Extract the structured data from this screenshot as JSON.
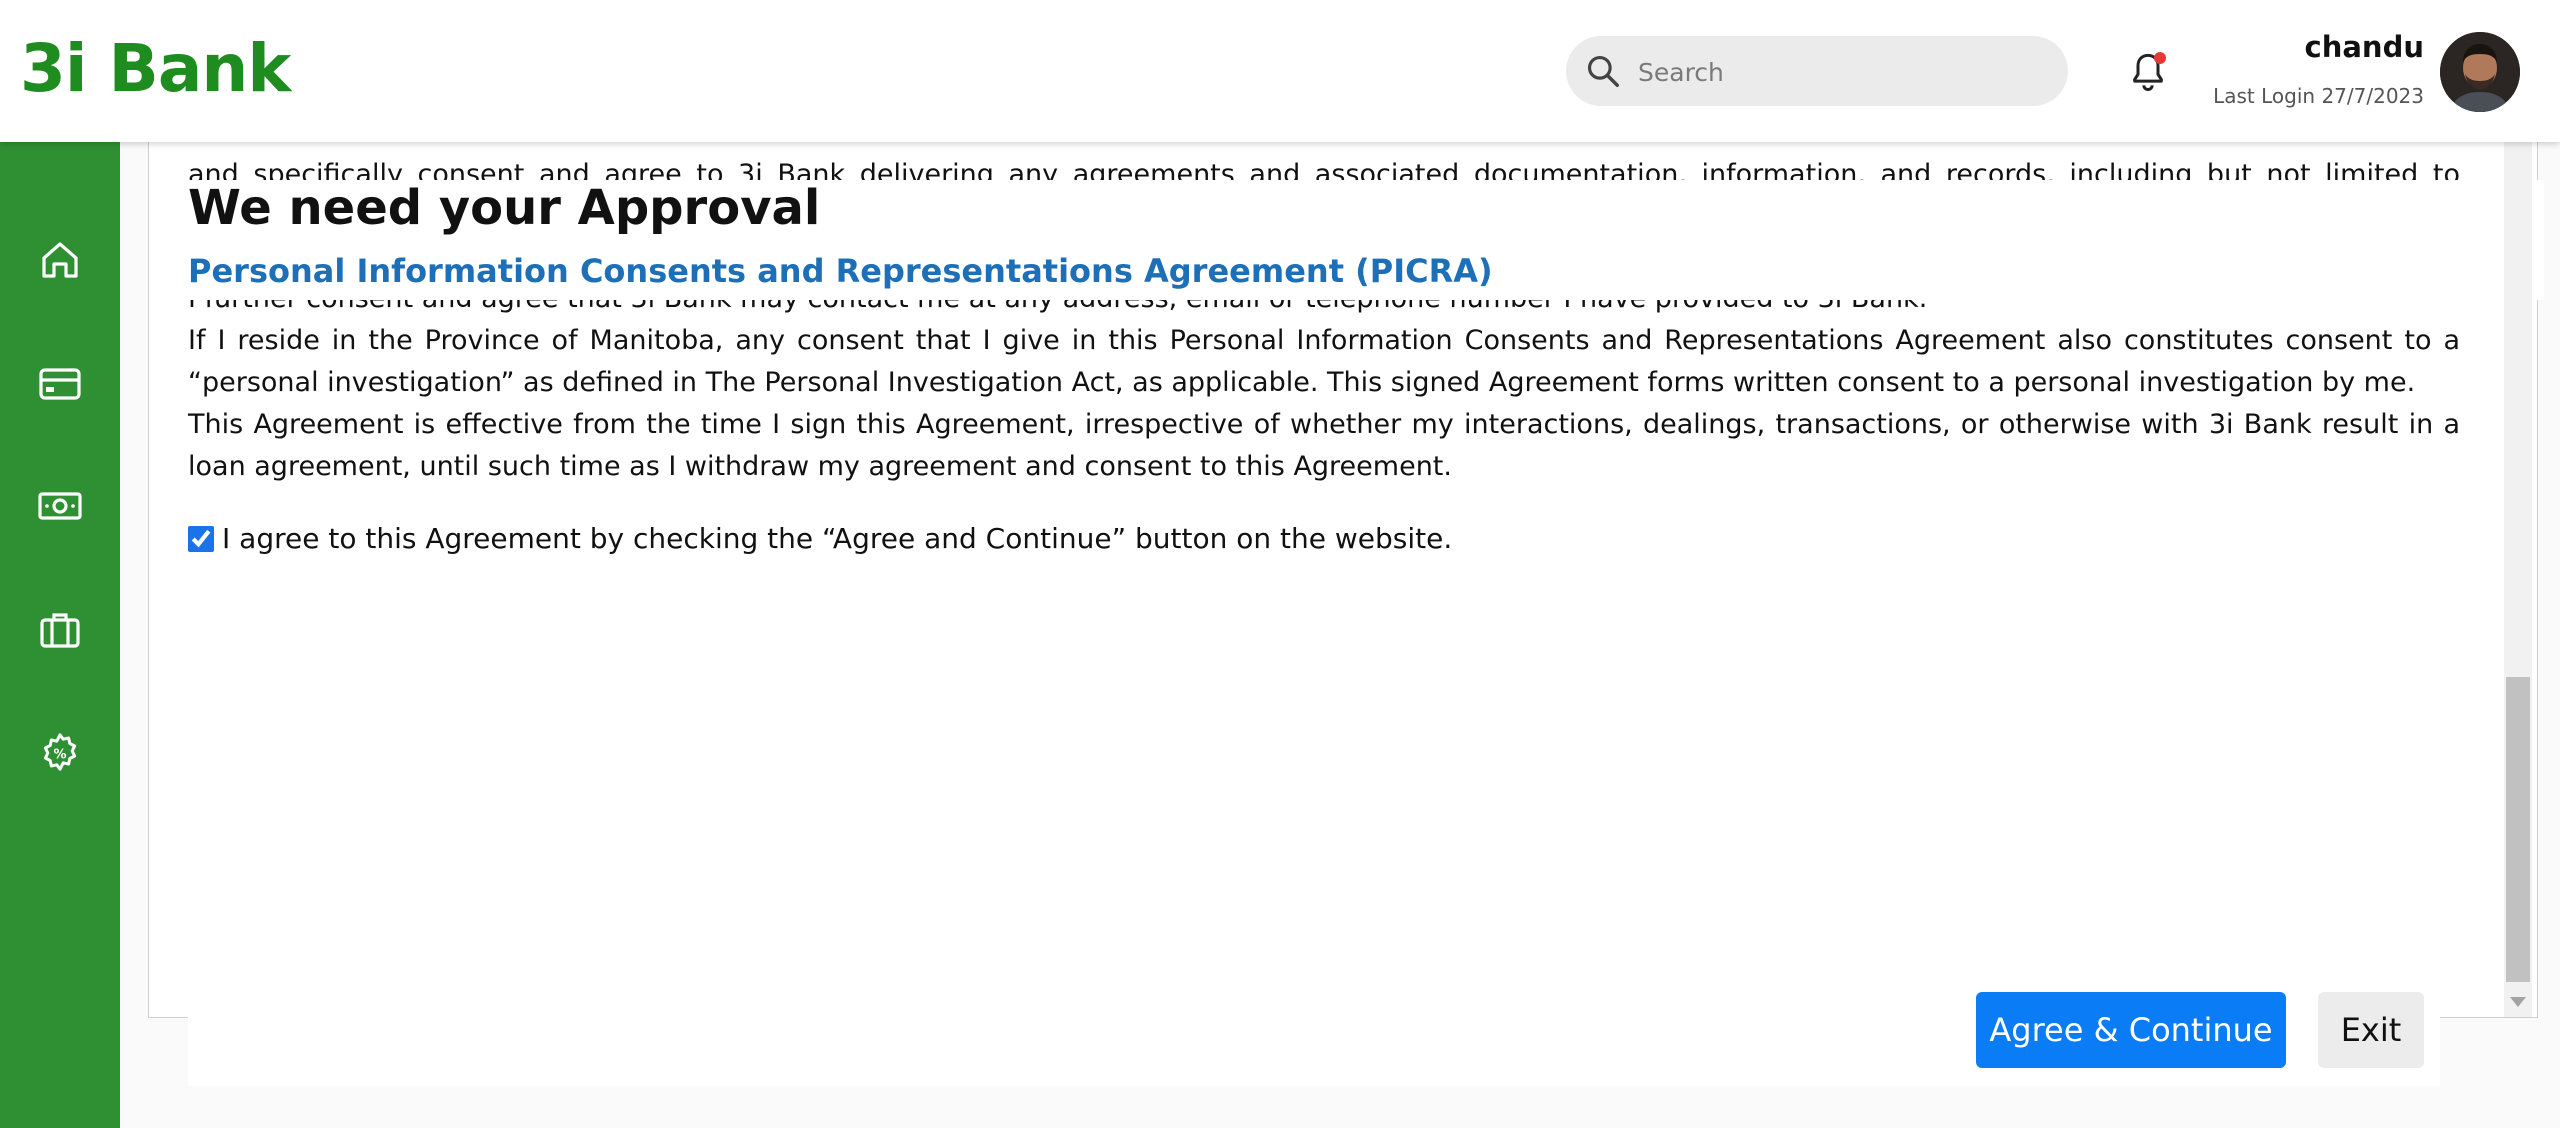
{
  "header": {
    "logo": "3i Bank",
    "search_placeholder": "Search",
    "user_name": "chandu",
    "last_login": "Last Login 27/7/2023",
    "notification_dot_color": "#e53935"
  },
  "sidebar": {
    "items": [
      {
        "icon": "home-icon"
      },
      {
        "icon": "credit-card-icon"
      },
      {
        "icon": "money-icon"
      },
      {
        "icon": "briefcase-icon"
      },
      {
        "icon": "percent-gear-icon"
      }
    ],
    "color": "#2f8f33"
  },
  "main": {
    "title": "We need your Approval",
    "subtitle": "Personal Information Consents and Representations Agreement (PICRA)",
    "scrolled_line_top": "and specifically consent and agree to 3i Bank delivering any agreements and associated documentation, information, and records, including but not limited to disclosures",
    "scrolled_line_under": "I further consent and agree that 3i Bank may contact me at any address, email or telephone number I have provided to 3i Bank.",
    "paragraphs": [
      "If I reside in the Province of Manitoba, any consent that I give in this Personal Information Consents and Representations Agreement also constitutes consent to a “personal investigation” as defined in The Personal Investigation Act, as applicable. This signed Agreement forms written consent to a personal investigation by me.",
      "This Agreement is effective from the time I sign this Agreement, irrespective of whether my interactions, dealings, transactions, or otherwise with 3i Bank result in a loan agreement, until such time as I withdraw my agreement and consent to this Agreement."
    ],
    "checkbox_label": "I agree to this Agreement by checking the “Agree and Continue” button on the website.",
    "checkbox_checked": true
  },
  "footer": {
    "agree_label": "Agree & Continue",
    "exit_label": "Exit"
  },
  "colors": {
    "brand": "#1e8c1e",
    "link_blue": "#1d6fb8",
    "primary_button": "#0a7cf6"
  }
}
